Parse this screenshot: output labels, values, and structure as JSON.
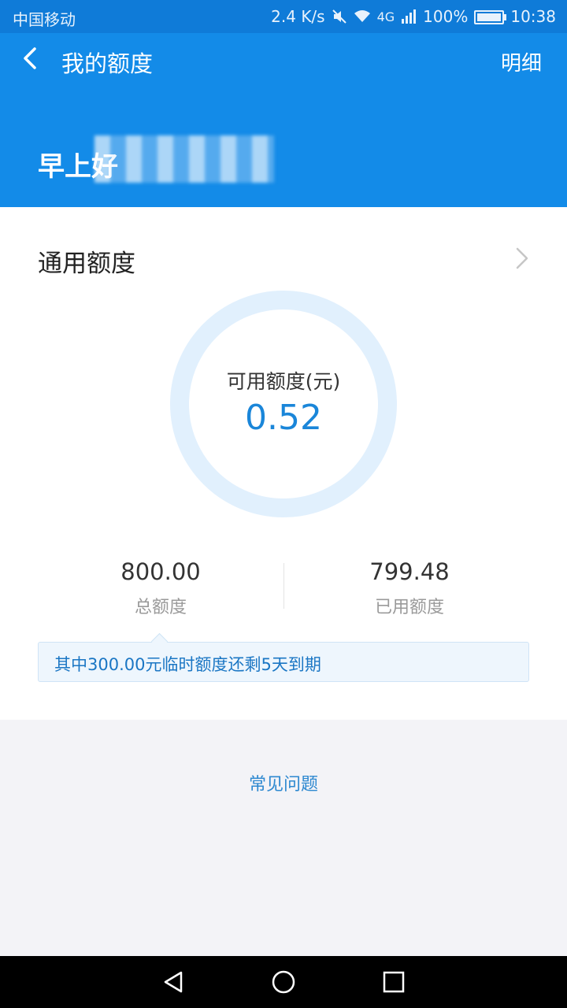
{
  "status_bar": {
    "carrier": "中国移动",
    "speed": "2.4 K/s",
    "network": "4G",
    "battery": "100%",
    "time": "10:38",
    "icons": [
      "mute-icon",
      "wifi-icon",
      "signal-icon",
      "battery-icon"
    ]
  },
  "app_bar": {
    "title": "我的额度",
    "detail_label": "明细"
  },
  "hero": {
    "greeting": "早上好"
  },
  "credit": {
    "section_title": "通用额度",
    "available_label": "可用额度(元)",
    "available_value": "0.52",
    "available_fraction": 0.00065,
    "total_value": "800.00",
    "total_label": "总额度",
    "used_value": "799.48",
    "used_label": "已用额度",
    "notice": "其中300.00元临时额度还剩5天到期"
  },
  "faq_label": "常见问题",
  "colors": {
    "primary": "#138be8",
    "ring_track": "#e1f0fd",
    "value_blue": "#1a86d9"
  }
}
